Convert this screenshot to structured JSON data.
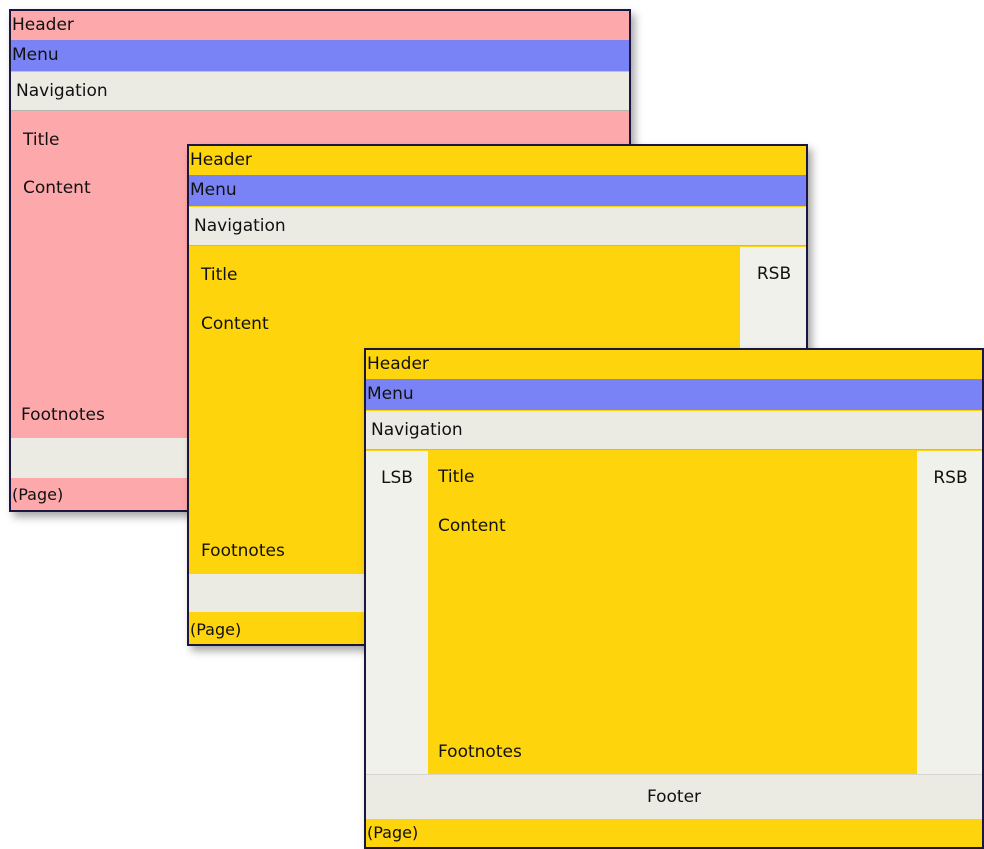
{
  "layouts": [
    {
      "header": "Header",
      "menu": "Menu",
      "navigation": "Navigation",
      "title": "Title",
      "content": "Content",
      "footnotes": "Footnotes",
      "page": "(Page)",
      "colors": {
        "background": "#fda9ab",
        "menu": "#7a83f5",
        "bars": "#ecebe3"
      }
    },
    {
      "header": "Header",
      "menu": "Menu",
      "navigation": "Navigation",
      "title": "Title",
      "content": "Content",
      "rsb": "RSB",
      "footnotes": "Footnotes",
      "page": "(Page)",
      "colors": {
        "background": "#fed40c",
        "menu": "#7a83f5",
        "bars": "#ecebe3"
      }
    },
    {
      "header": "Header",
      "menu": "Menu",
      "navigation": "Navigation",
      "lsb": "LSB",
      "title": "Title",
      "content": "Content",
      "rsb": "RSB",
      "footnotes": "Footnotes",
      "footer": "Footer",
      "page": "(Page)",
      "colors": {
        "background": "#fed40c",
        "menu": "#7a83f5",
        "bars": "#ecebe3"
      }
    }
  ]
}
